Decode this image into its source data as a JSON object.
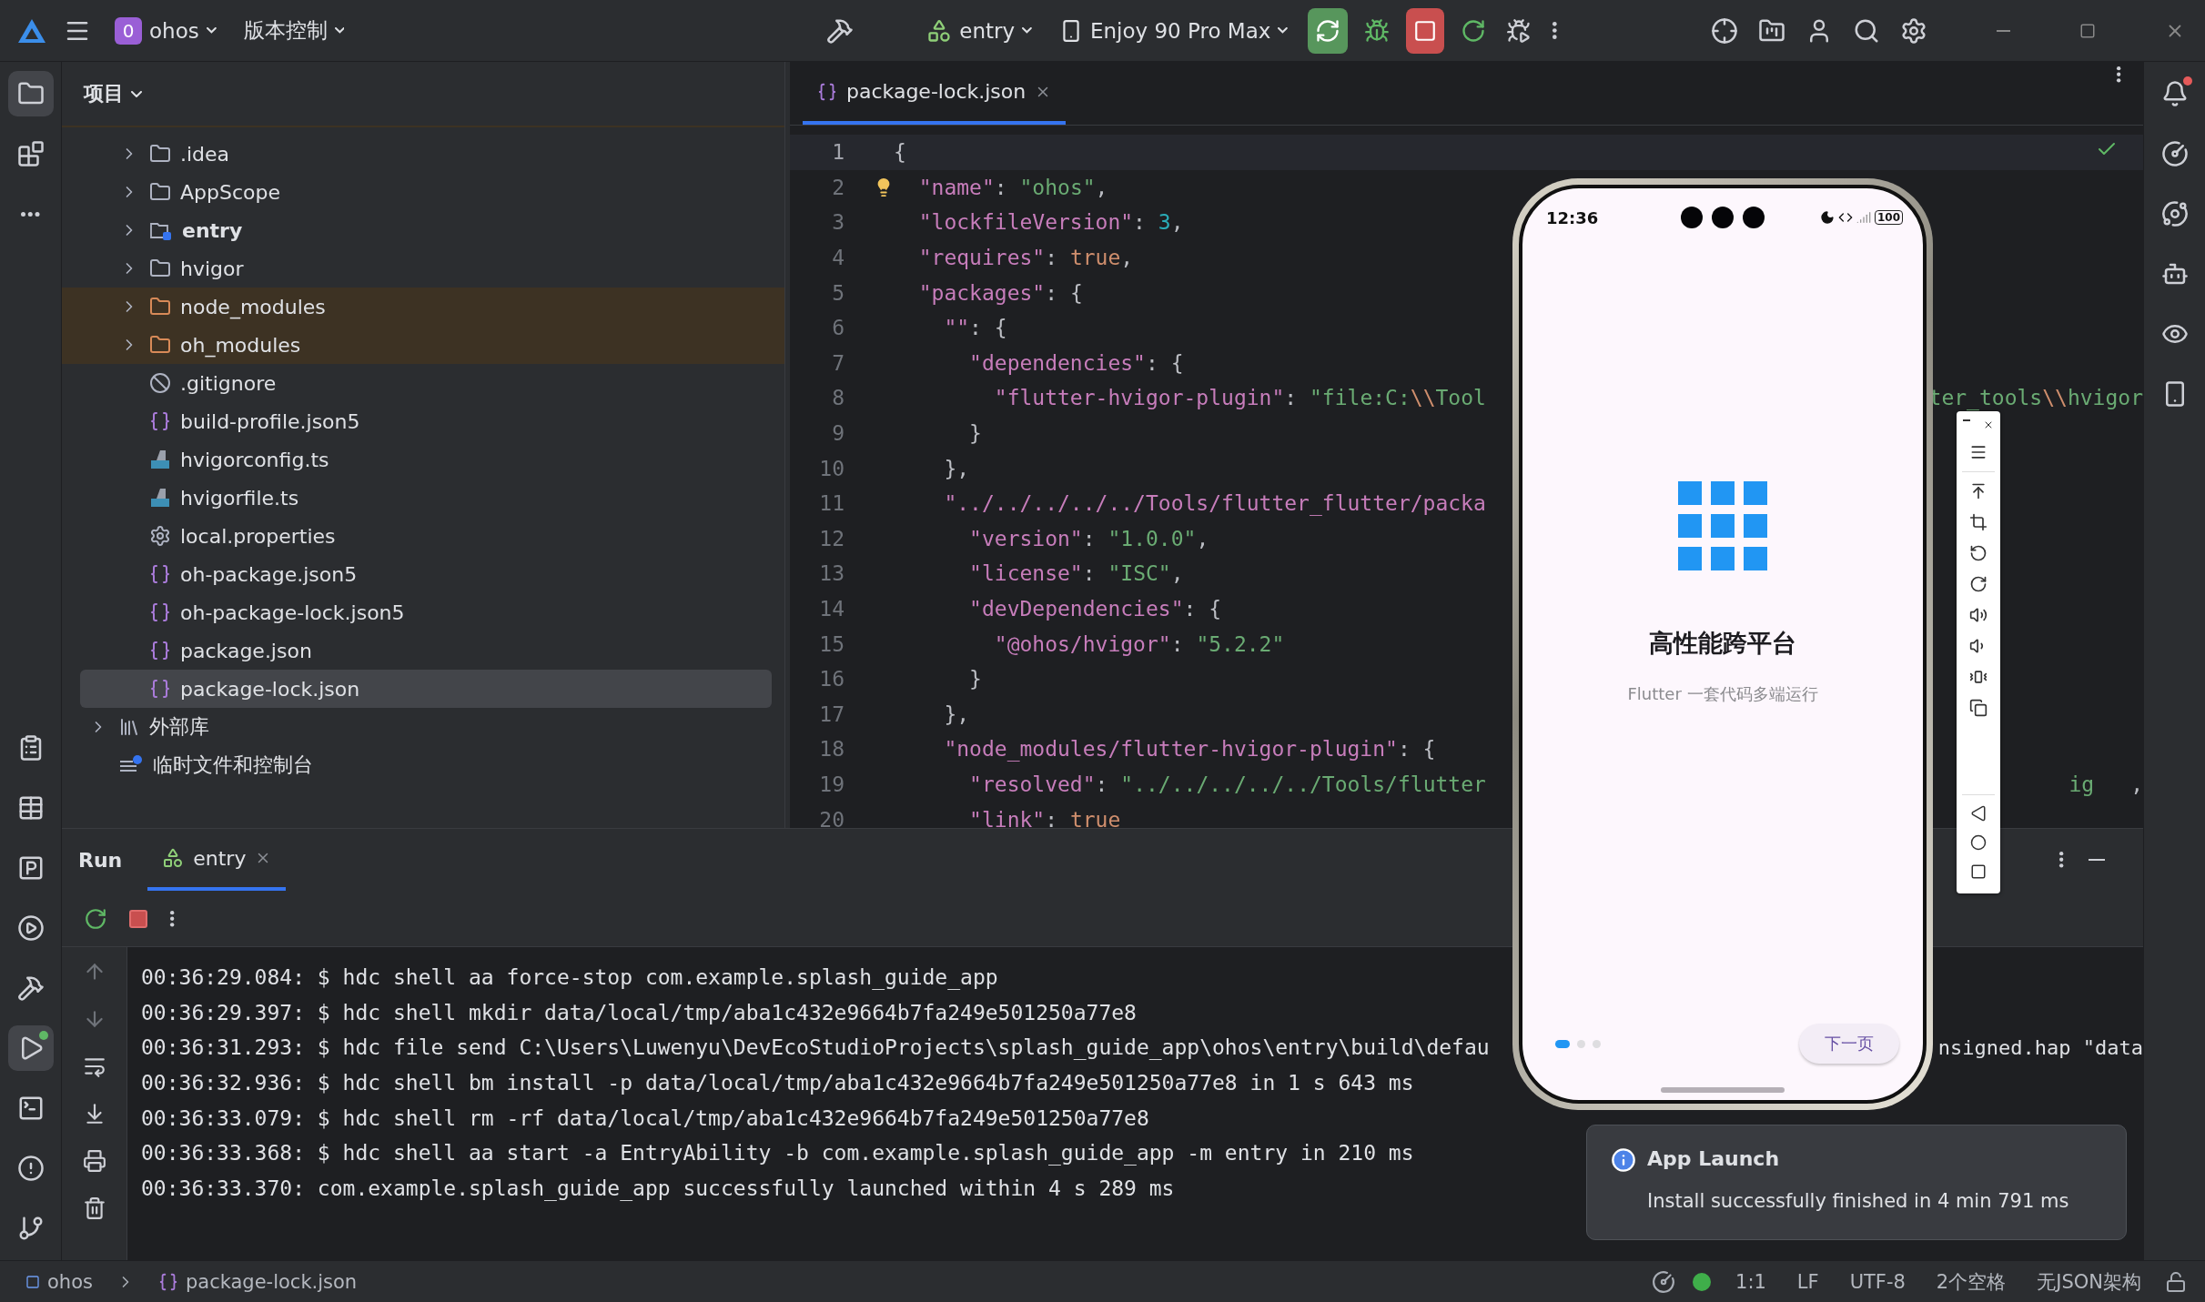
{
  "top_bar": {
    "project_badge": "0",
    "project": "ohos",
    "vcs": "版本控制",
    "run_config": "entry",
    "device": "Enjoy 90 Pro Max"
  },
  "left_toolbar": {
    "top": [
      {
        "selected": true
      },
      {
        "selected": false
      },
      {
        "selected": false
      }
    ],
    "bottom": [
      {
        "selected": false
      },
      {
        "selected": false
      },
      {
        "selected": false
      },
      {
        "selected": false
      },
      {
        "selected": false
      },
      {
        "selected": true
      },
      {
        "selected": false
      },
      {
        "selected": false
      },
      {
        "selected": false
      }
    ]
  },
  "project_panel": {
    "title": "项目",
    "items": [
      {
        "label": ".idea",
        "kind": "folder",
        "expanded": false,
        "excluded": false,
        "selected": false
      },
      {
        "label": "AppScope",
        "kind": "folder",
        "expanded": false,
        "excluded": false,
        "selected": false
      },
      {
        "label": "entry",
        "kind": "module",
        "expanded": false,
        "excluded": false,
        "selected": false
      },
      {
        "label": "hvigor",
        "kind": "folder",
        "expanded": false,
        "excluded": false,
        "selected": false
      },
      {
        "label": "node_modules",
        "kind": "folder",
        "expanded": false,
        "excluded": true,
        "selected": false
      },
      {
        "label": "oh_modules",
        "kind": "folder",
        "expanded": false,
        "excluded": true,
        "selected": false
      },
      {
        "label": ".gitignore",
        "kind": "ignore",
        "excluded": false,
        "selected": false
      },
      {
        "label": "build-profile.json5",
        "kind": "json",
        "excluded": false,
        "selected": false
      },
      {
        "label": "hvigorconfig.ts",
        "kind": "ts",
        "excluded": false,
        "selected": false
      },
      {
        "label": "hvigorfile.ts",
        "kind": "ts",
        "excluded": false,
        "selected": false
      },
      {
        "label": "local.properties",
        "kind": "properties",
        "excluded": false,
        "selected": false
      },
      {
        "label": "oh-package.json5",
        "kind": "json",
        "excluded": false,
        "selected": false
      },
      {
        "label": "oh-package-lock.json5",
        "kind": "json",
        "excluded": false,
        "selected": false
      },
      {
        "label": "package.json",
        "kind": "json",
        "excluded": false,
        "selected": false
      },
      {
        "label": "package-lock.json",
        "kind": "json",
        "excluded": false,
        "selected": true
      }
    ],
    "roots": [
      {
        "label": "外部库",
        "kind": "library",
        "expanded": false
      },
      {
        "label": "临时文件和控制台",
        "kind": "scratch"
      }
    ]
  },
  "editor": {
    "tabs": [
      {
        "label": "package-lock.json",
        "selected": true
      }
    ],
    "lines": [
      {
        "number": "1",
        "text": "{",
        "current": true
      },
      {
        "number": "2",
        "text": "  \"name\": \"ohos\",",
        "hint": true,
        "current": false
      },
      {
        "number": "3",
        "text": "  \"lockfileVersion\": 3,",
        "current": false
      },
      {
        "number": "4",
        "text": "  \"requires\": true,",
        "current": false
      },
      {
        "number": "5",
        "text": "  \"packages\": {",
        "current": false
      },
      {
        "number": "6",
        "text": "    \"\": {",
        "current": false
      },
      {
        "number": "7",
        "text": "      \"dependencies\": {",
        "current": false
      },
      {
        "number": "8",
        "text": "        \"flutter-hvigor-plugin\": \"file:C:\\\\Tool",
        "tail": [
          "ter_tools\\\\hvigor"
        ],
        "current": false
      },
      {
        "number": "9",
        "text": "      }",
        "current": false
      },
      {
        "number": "10",
        "text": "    },",
        "current": false
      },
      {
        "number": "11",
        "text": "    \"../../../../../Tools/flutter_flutter/packa",
        "current": false
      },
      {
        "number": "12",
        "text": "      \"version\": \"1.0.0\",",
        "current": false
      },
      {
        "number": "13",
        "text": "      \"license\": \"ISC\",",
        "current": false
      },
      {
        "number": "14",
        "text": "      \"devDependencies\": {",
        "current": false
      },
      {
        "number": "15",
        "text": "        \"@ohos/hvigor\": \"5.2.2\"",
        "current": false
      },
      {
        "number": "16",
        "text": "      }",
        "current": false
      },
      {
        "number": "17",
        "text": "    },",
        "current": false
      },
      {
        "number": "18",
        "text": "    \"node_modules/flutter-hvigor-plugin\": {",
        "current": false
      },
      {
        "number": "19",
        "text": "      \"resolved\": \"../../../../../Tools/flutter",
        "tail": [
          "ig",
          ","
        ],
        "current": false
      },
      {
        "number": "20",
        "text": "      \"link\": true",
        "current": false
      }
    ]
  },
  "run_panel": {
    "title": "Run",
    "tabs": [
      {
        "label": "entry",
        "selected": true
      }
    ],
    "console": [
      {
        "text": "00:36:29.084: $ hdc shell aa force-stop com.example.splash_guide_app"
      },
      {
        "text": "00:36:29.397: $ hdc shell mkdir data/local/tmp/aba1c432e9664b7fa249e501250a77e8"
      },
      {
        "text": "00:36:31.293: $ hdc file send C:\\Users\\Luwenyu\\DevEcoStudioProjects\\splash_guide_app\\ohos\\entry\\build\\defau",
        "tail": "nsigned.hap \"data"
      },
      {
        "text": "00:36:32.936: $ hdc shell bm install -p data/local/tmp/aba1c432e9664b7fa249e501250a77e8 in 1 s 643 ms"
      },
      {
        "text": "00:36:33.079: $ hdc shell rm -rf data/local/tmp/aba1c432e9664b7fa249e501250a77e8"
      },
      {
        "text": "00:36:33.368: $ hdc shell aa start -a EntryAbility -b com.example.splash_guide_app -m entry in 210 ms"
      },
      {
        "text": "00:36:33.370: com.example.splash_guide_app successfully launched within 4 s 289 ms"
      }
    ]
  },
  "emulator": {
    "time": "12:36",
    "battery": "100",
    "title": "高性能跨平台",
    "subtitle": "Flutter 一套代码多端运行",
    "pages": [
      {
        "selected": true
      },
      {
        "selected": false
      },
      {
        "selected": false
      }
    ],
    "next_button": "下一页"
  },
  "notification": {
    "title": "App Launch",
    "message": "Install successfully finished in 4 min 791 ms"
  },
  "status_bar": {
    "path": [
      "ohos",
      "package-lock.json"
    ],
    "items": [
      "1:1",
      "LF",
      "UTF-8",
      "2个空格",
      "无JSON架构"
    ]
  }
}
